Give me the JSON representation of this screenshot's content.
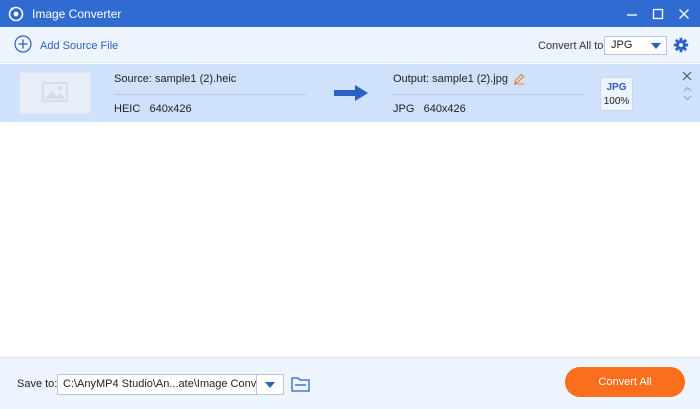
{
  "window": {
    "title": "Image Converter"
  },
  "toolbar": {
    "add_source_label": "Add Source File",
    "convert_all_label": "Convert All to:",
    "convert_all_value": "JPG"
  },
  "file_item": {
    "source_name": "Source: sample1 (2).heic",
    "source_format": "HEIC",
    "source_resolution": "640x426",
    "output_name": "Output: sample1 (2).jpg",
    "output_format": "JPG",
    "output_resolution": "640x426",
    "badge_format": "JPG",
    "badge_quality": "100%"
  },
  "footer": {
    "save_to_label": "Save to:",
    "save_path": "C:\\AnyMP4 Studio\\An...ate\\Image Converter",
    "convert_button_label": "Convert All"
  },
  "colors": {
    "titlebar": "#2f6bd0",
    "accent_blue": "#2b60c4",
    "row_bg": "#cfe1fb",
    "toolbar_bg": "#eef4fd",
    "convert_button": "#fb6e1c",
    "edit_icon": "#f07a2c"
  },
  "icons": {
    "app": "app-logo-icon",
    "add": "plus-circle-icon",
    "settings": "gear-icon",
    "thumbnail": "image-placeholder-icon",
    "arrow": "arrow-right-icon",
    "edit": "pencil-icon",
    "close": "close-icon",
    "up": "chevron-up-icon",
    "down": "chevron-down-icon",
    "folder": "folder-icon"
  }
}
